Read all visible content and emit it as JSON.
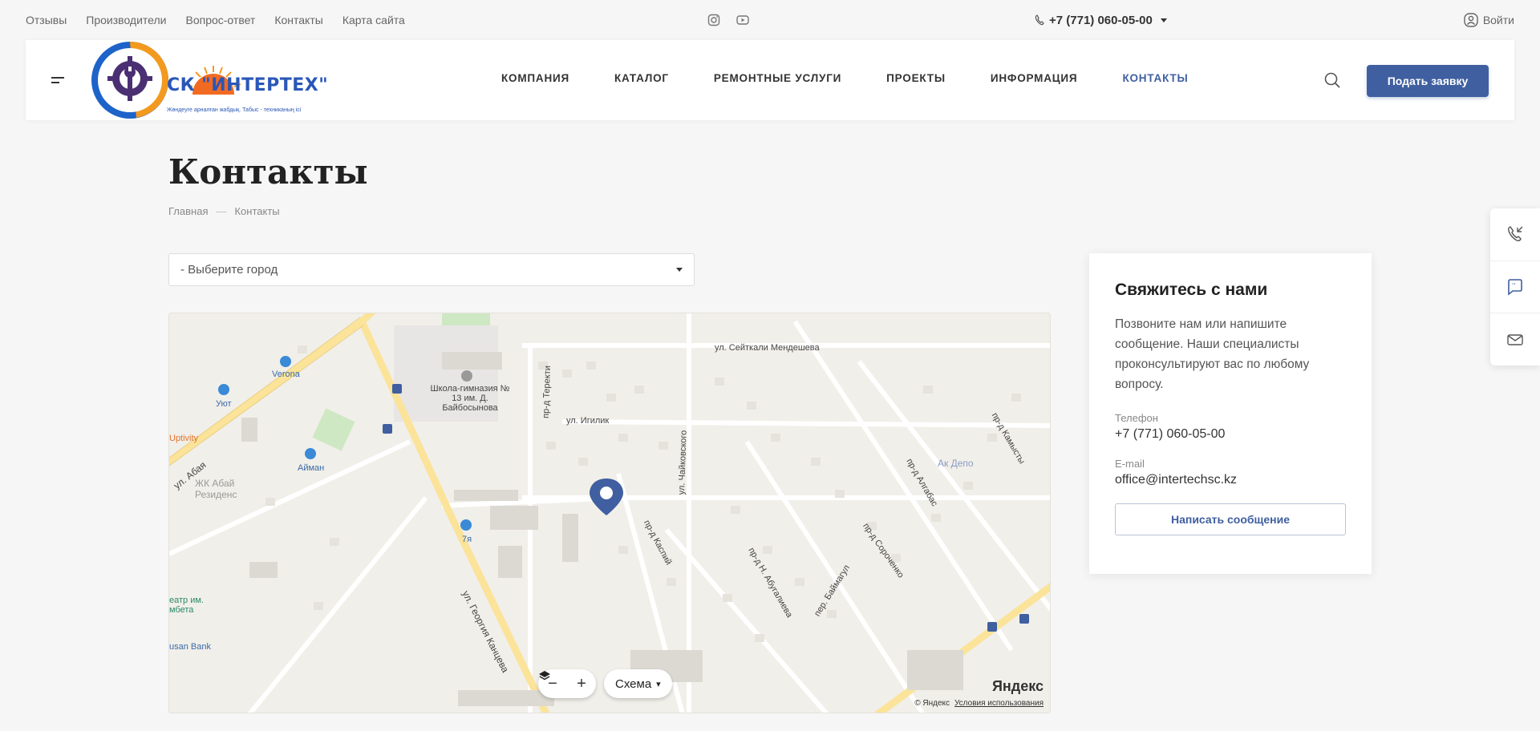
{
  "topbar": {
    "links": [
      "Отзывы",
      "Производители",
      "Вопрос-ответ",
      "Контакты",
      "Карта сайта"
    ],
    "phone": "+7 (771) 060-05-00",
    "login": "Войти"
  },
  "header": {
    "logo_text": "СК \"ИНТЕРТЕХ\"",
    "logo_tagline": "Жөндеуге арналған жабдық. Табыс - техниканың ісі",
    "nav": [
      "КОМПАНИЯ",
      "КАТАЛОГ",
      "РЕМОНТНЫЕ УСЛУГИ",
      "ПРОЕКТЫ",
      "ИНФОРМАЦИЯ",
      "КОНТАКТЫ"
    ],
    "active_nav": "КОНТАКТЫ",
    "cta": "Подать заявку"
  },
  "page": {
    "title": "Контакты",
    "breadcrumb": [
      "Главная",
      "Контакты"
    ]
  },
  "city_select": {
    "value": "- Выберите город"
  },
  "map": {
    "labels": {
      "street_seitkali": "ул. Сейткали Мендешева",
      "street_igilik": "ул. Игилик",
      "street_abaya": "ул. Абая",
      "street_kantseva": "ул. Георгия Канцева",
      "street_chaikovskogo": "ул. Чайковского",
      "street_kaspiy": "пр-д Каспий",
      "street_abugalieva": "пр-д Н. Абугалиева",
      "street_baimagul": "пер. Баймагул",
      "street_sorochenko": "пр-д Сороченко",
      "street_algabas": "пр-д Алгабас",
      "street_kamysty": "пр-д Камысты",
      "street_terekti": "пр-д Теректи",
      "school": "Школа-гимназия № 13 им. Д. Байбосынова",
      "residence": "ЖК Абай Резиденс",
      "ak_depo": "Ак Депо",
      "verona": "Verona",
      "uyut": "Уют",
      "aiman": "Айман",
      "seven_ya": "7я",
      "uptivity": "Uptivity",
      "theatre": "еатр им. мбета",
      "bank": "usan Bank"
    },
    "layers_label": "Схема",
    "zoom_out": "−",
    "zoom_in": "+",
    "copyright": "© Яндекс",
    "terms": "Условия использования",
    "brand": "Яндекс"
  },
  "contact_card": {
    "title": "Свяжитесь с нами",
    "description": "Позвоните нам или напишите сообщение. Наши специалисты проконсультируют вас по любому вопросу.",
    "phone_label": "Телефон",
    "phone": "+7 (771) 060-05-00",
    "email_label": "E-mail",
    "email": "office@intertechsc.kz",
    "write_button": "Написать сообщение"
  },
  "colors": {
    "accent": "#3f5fa0",
    "road_major": "#fbe39a",
    "map_bg": "#f1efe9",
    "marker": "#3f5fa0"
  }
}
